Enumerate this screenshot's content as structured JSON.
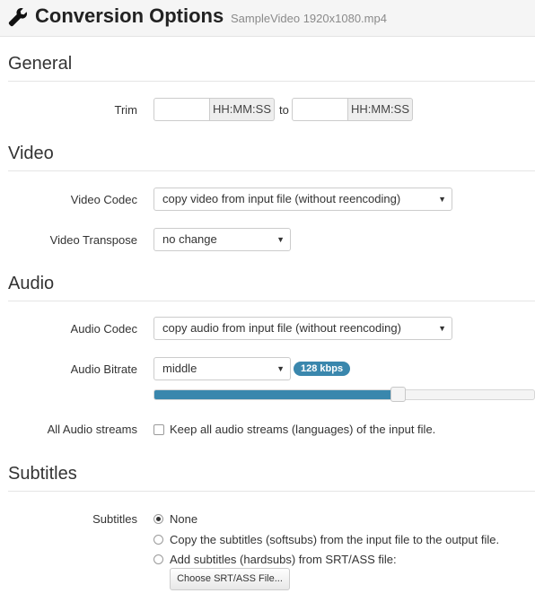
{
  "header": {
    "title": "Conversion Options",
    "filename": "SampleVideo 1920x1080.mp4",
    "icon": "wrench-icon"
  },
  "general": {
    "section_title": "General",
    "trim": {
      "label": "Trim",
      "start_value": "",
      "start_addon": "HH:MM:SS",
      "separator": "to",
      "end_value": "",
      "end_addon": "HH:MM:SS"
    }
  },
  "video": {
    "section_title": "Video",
    "codec": {
      "label": "Video Codec",
      "selected": "copy video from input file (without reencoding)"
    },
    "transpose": {
      "label": "Video Transpose",
      "selected": "no change"
    }
  },
  "audio": {
    "section_title": "Audio",
    "codec": {
      "label": "Audio Codec",
      "selected": "copy audio from input file (without reencoding)"
    },
    "bitrate": {
      "label": "Audio Bitrate",
      "selected": "middle",
      "badge": "128 kbps",
      "slider_fraction": 0.64
    },
    "all_streams": {
      "label": "All Audio streams",
      "checkbox_text": "Keep all audio streams (languages) of the input file.",
      "checked": false
    }
  },
  "subtitles": {
    "section_title": "Subtitles",
    "label": "Subtitles",
    "options": [
      {
        "text": "None",
        "checked": true
      },
      {
        "text": "Copy the subtitles (softsubs) from the input file to the output file.",
        "checked": false
      },
      {
        "text": "Add subtitles (hardsubs) from SRT/ASS file:",
        "checked": false
      }
    ],
    "file_button": "Choose SRT/ASS File..."
  },
  "colors": {
    "accent": "#3a87ad",
    "header_bg": "#f5f5f5"
  }
}
